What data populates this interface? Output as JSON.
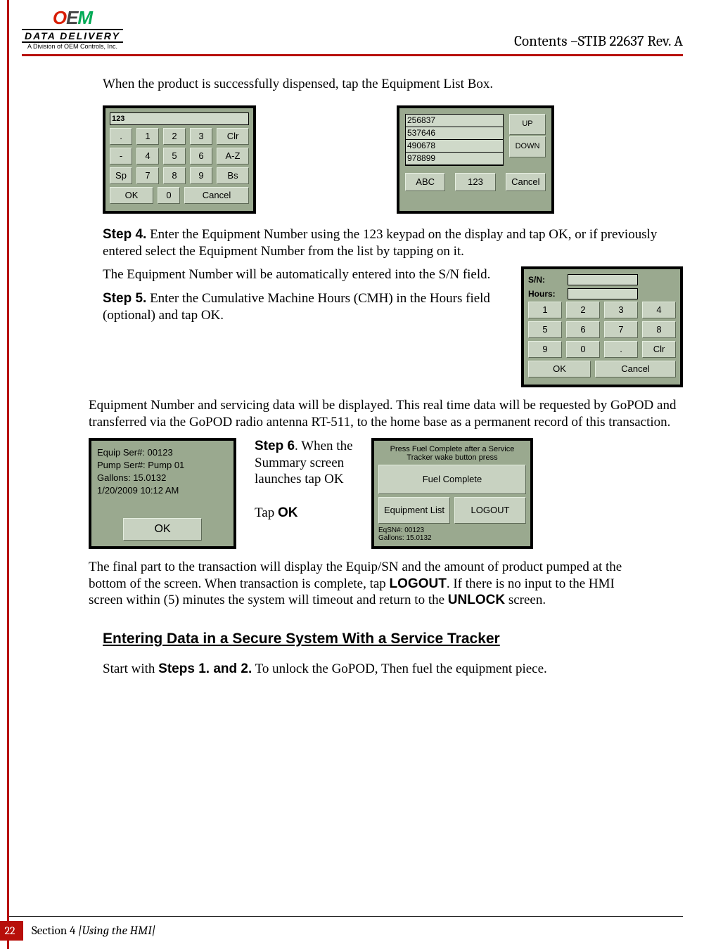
{
  "header": {
    "logo_top": "OEM",
    "logo_mid": "DATA DELIVERY",
    "logo_sub": "A Division of OEM Controls, Inc.",
    "doc_title": "Contents –STIB 22637 Rev. A"
  },
  "intro": "When the product is successfully dispensed, tap the Equipment List Box.",
  "hmi_keypad": {
    "display_label": "123",
    "rows": [
      [
        ".",
        "1",
        "2",
        "3",
        "Clr"
      ],
      [
        "-",
        "4",
        "5",
        "6",
        "A-Z"
      ],
      [
        "Sp",
        "7",
        "8",
        "9",
        "Bs"
      ],
      [
        "OK",
        "0",
        "Cancel"
      ]
    ]
  },
  "hmi_list": {
    "items": [
      "256837",
      "537646",
      "490678",
      "978899"
    ],
    "up": "UP",
    "down": "DOWN",
    "btns": [
      "ABC",
      "123",
      "Cancel"
    ]
  },
  "step4": {
    "label": "Step 4.",
    "text": " Enter the Equipment Number using the 123 keypad on the display and tap OK, or if previously entered select the Equipment Number from the list by tapping on it."
  },
  "sn_auto": "The Equipment Number will be automatically entered into the S/N field.",
  "step5": {
    "label": "Step 5.",
    "text": " Enter the Cumulative Machine Hours (CMH) in the Hours field (optional) and tap OK."
  },
  "hmi_sn": {
    "sn_label": "S/N:",
    "hours_label": "Hours:",
    "rows": [
      [
        "1",
        "2",
        "3",
        "4"
      ],
      [
        "5",
        "6",
        "7",
        "8"
      ],
      [
        "9",
        "0",
        ".",
        "Clr"
      ]
    ],
    "ok": "OK",
    "cancel": "Cancel"
  },
  "para_equip": "Equipment Number and servicing data will be displayed. This real time data will be requested by GoPOD and transferred via the GoPOD radio antenna RT-511, to the home base as a permanent record of this transaction.",
  "hmi_summary": {
    "line1": "Equip Ser#: 00123",
    "line2": "Pump Ser#: Pump 01",
    "line3": "Gallons: 15.0132",
    "line4": "1/20/2009 10:12 AM",
    "ok": "OK"
  },
  "step6": {
    "label": "Step 6",
    "text1": ". When the Summary screen launches tap OK",
    "tap": "Tap ",
    "ok_bold": "OK"
  },
  "hmi_fuel": {
    "msg": "Press Fuel Complete after a Service Tracker wake button press",
    "fuel_complete": "Fuel Complete",
    "equip_list": "Equipment List",
    "logout": "LOGOUT",
    "status1": "EqSN#: 00123",
    "status2": "Gallons: 15.0132"
  },
  "para_final": {
    "t1": "The final part to the transaction will display the Equip/SN and the amount of product pumped at the bottom of the screen. When transaction is complete, tap ",
    "b1": "LOGOUT",
    "t2": ". If there is no input to the HMI screen within (5) minutes the system will timeout and return to the ",
    "b2": "UNLOCK",
    "t3": " screen."
  },
  "section_head": "Entering Data in a Secure System With a Service Tracker",
  "para_start": {
    "t1": "Start with ",
    "b1": "Steps 1. and 2.",
    "t2": " To unlock the GoPOD, Then fuel the equipment piece."
  },
  "footer": {
    "page": "22",
    "section": "Section 4 ",
    "title": "|Using the HMI|"
  }
}
